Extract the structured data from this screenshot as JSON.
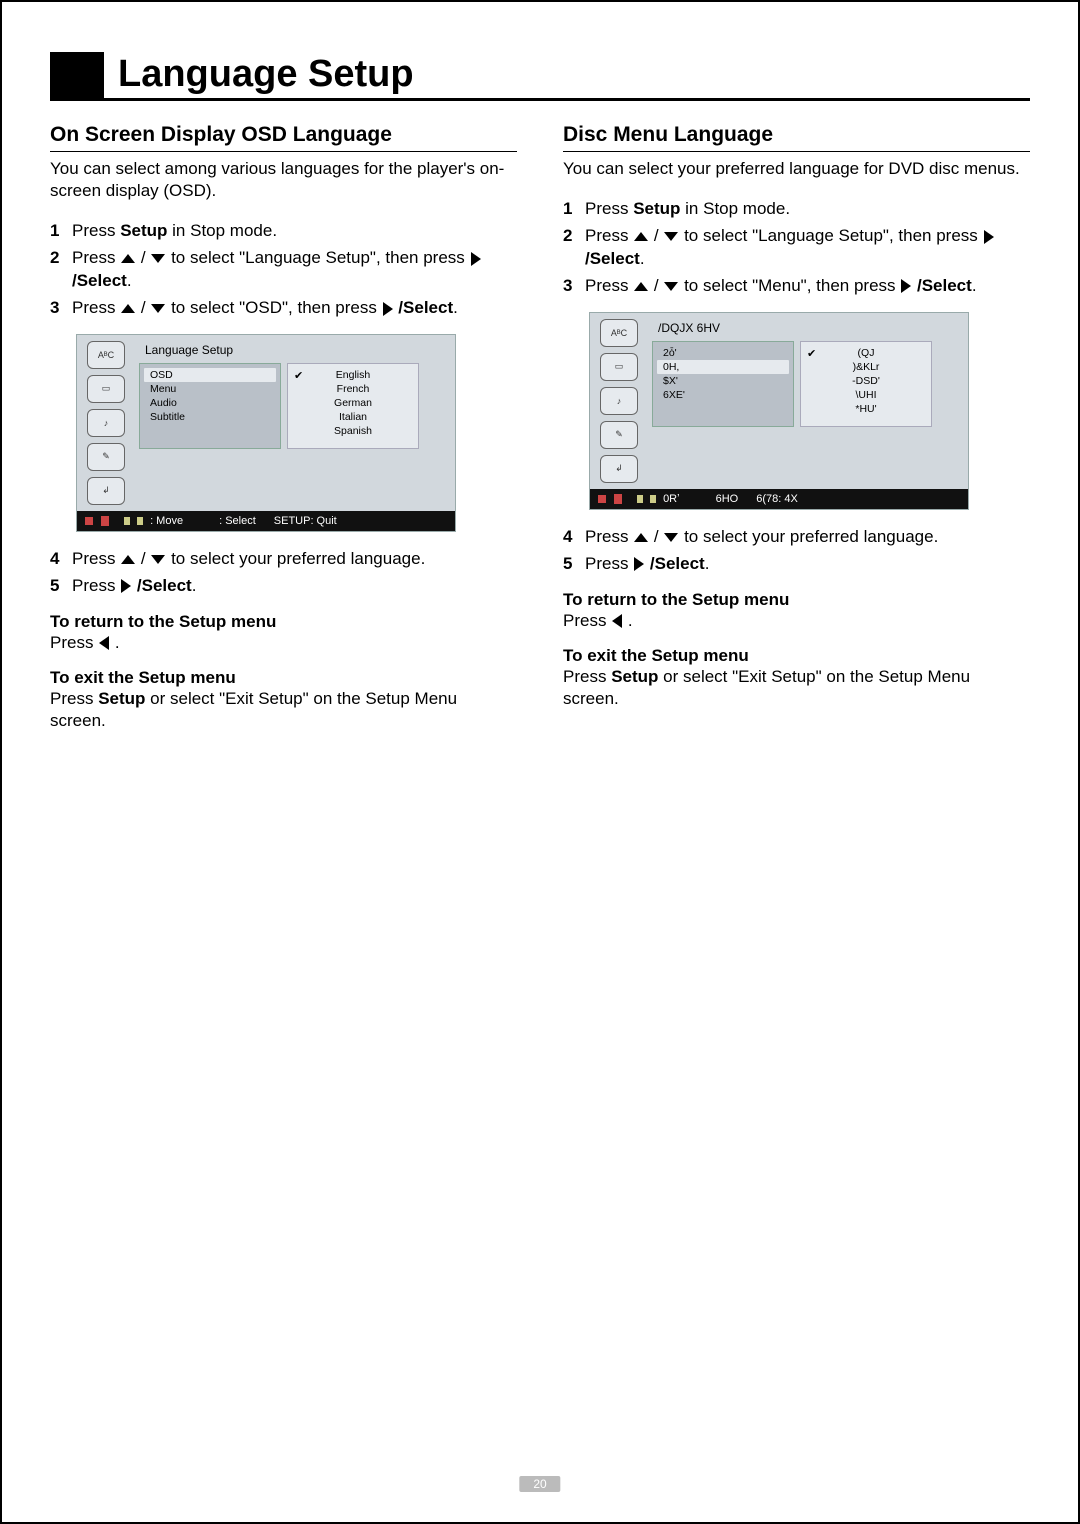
{
  "title": "Language Setup",
  "page_number": "20",
  "arrow_sep": " / ",
  "left": {
    "heading": "On Screen Display OSD Language",
    "intro": "You can select among various languages for the player's on-screen display (OSD).",
    "step1_a": "Press ",
    "step1_b": "Setup",
    "step1_c": " in Stop mode.",
    "step2_a": "Press ",
    "step2_b": " to select \"Language Setup\", then press ",
    "step2_c": " /Select",
    "step2_d": ".",
    "step3_a": "Press ",
    "step3_b": " to select \"OSD\", then press ",
    "step3_c": " /Select",
    "step3_d": ".",
    "step4_a": "Press ",
    "step4_b": " to select your preferred language.",
    "step5_a": "Press ",
    "step5_b": " /Select",
    "step5_c": ".",
    "return_h": "To return to the Setup menu",
    "return_a": "Press ",
    "return_b": " .",
    "exit_h": "To exit the Setup menu",
    "exit_a": "Press ",
    "exit_b": "Setup",
    "exit_c": " or select \"Exit Setup\" on the Setup Menu screen.",
    "osd": {
      "title": "Language Setup",
      "menu": [
        "OSD",
        "Menu",
        "Audio",
        "Subtitle"
      ],
      "selected_menu": 0,
      "opts": [
        "English",
        "French",
        "German",
        "Italian",
        "Spanish"
      ],
      "selected_opt": 0,
      "footer_move": ": Move",
      "footer_select": ": Select",
      "footer_quit": "SETUP: Quit"
    }
  },
  "right": {
    "heading": "Disc Menu Language",
    "intro": "You can select your preferred language for DVD disc menus.",
    "step1_a": "Press ",
    "step1_b": "Setup",
    "step1_c": " in Stop mode.",
    "step2_a": "Press ",
    "step2_b": " to select \"Language Setup\", then press ",
    "step2_c": " /Select",
    "step2_d": ".",
    "step3_a": "Press ",
    "step3_b": " to select \"Menu\", then press ",
    "step3_c": " /Select",
    "step3_d": ".",
    "step4_a": "Press ",
    "step4_b": " to select your preferred language.",
    "step5_a": "Press ",
    "step5_b": " /Select",
    "step5_c": ".",
    "return_h": "To return to the Setup menu",
    "return_a": "Press ",
    "return_b": " .",
    "exit_h": "To exit the Setup menu",
    "exit_a": "Press ",
    "exit_b": "Setup",
    "exit_c": " or select \"Exit Setup\" on the Setup Menu screen.",
    "osd": {
      "title": "/DQJX 6HV",
      "menu": [
        "2ȱ'",
        "0H,",
        "$X'",
        "6XE'"
      ],
      "selected_menu": 1,
      "opts": [
        "(QJ",
        ")&KLr",
        "-DSD'",
        "\\UHI",
        "*HU'"
      ],
      "selected_opt": 0,
      "footer_move": "0Rʼ",
      "footer_select": "6HO",
      "footer_quit": "6(78: 4X"
    }
  }
}
